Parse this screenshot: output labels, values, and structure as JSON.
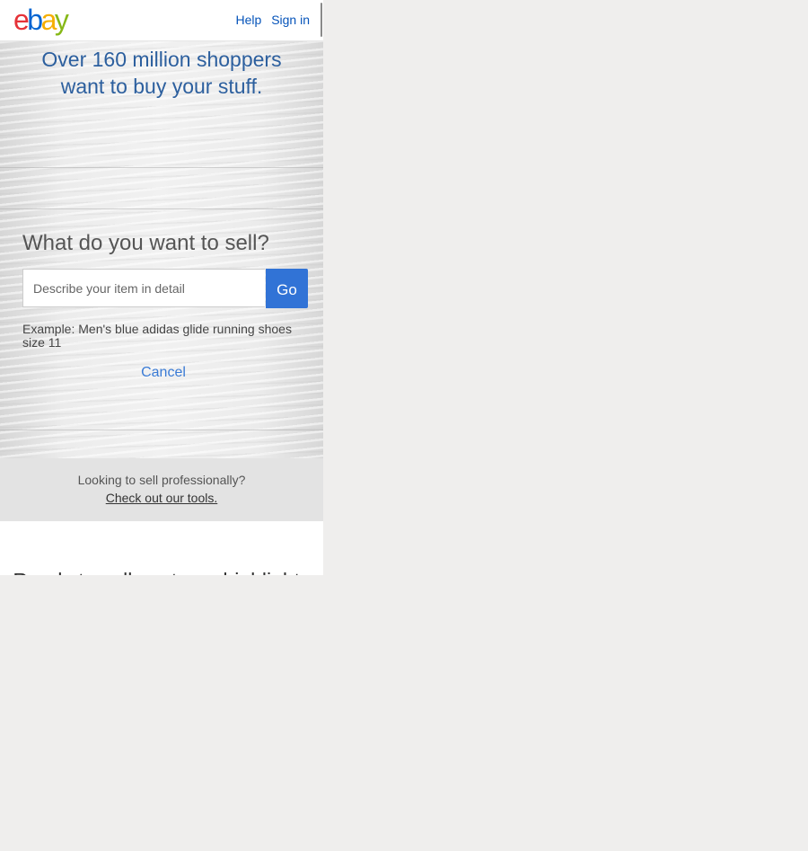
{
  "header": {
    "logo_letters": [
      {
        "char": "e",
        "color": "#e53238"
      },
      {
        "char": "b",
        "color": "#0064d2"
      },
      {
        "char": "a",
        "color": "#f5af02"
      },
      {
        "char": "y",
        "color": "#86b817"
      }
    ],
    "help_label": "Help",
    "signin_label": "Sign in"
  },
  "hero": {
    "title_line1": "Over 160 million shoppers",
    "title_line2": "want to buy your stuff."
  },
  "sell_form": {
    "heading": "What do you want to sell?",
    "input_placeholder": "Describe your item in detail",
    "input_value": "",
    "go_label": "Go",
    "example": "Example: Men's blue adidas glide running shoes size 11",
    "cancel_label": "Cancel"
  },
  "pro": {
    "question": "Looking to sell professionally?",
    "link": "Check out our tools."
  },
  "below_fold": {
    "heading_partial": "Ready to sell next gen highlights"
  },
  "colors": {
    "link_blue": "#0654ba",
    "go_button": "#3173d6",
    "hero_title": "#2c5f9e"
  }
}
